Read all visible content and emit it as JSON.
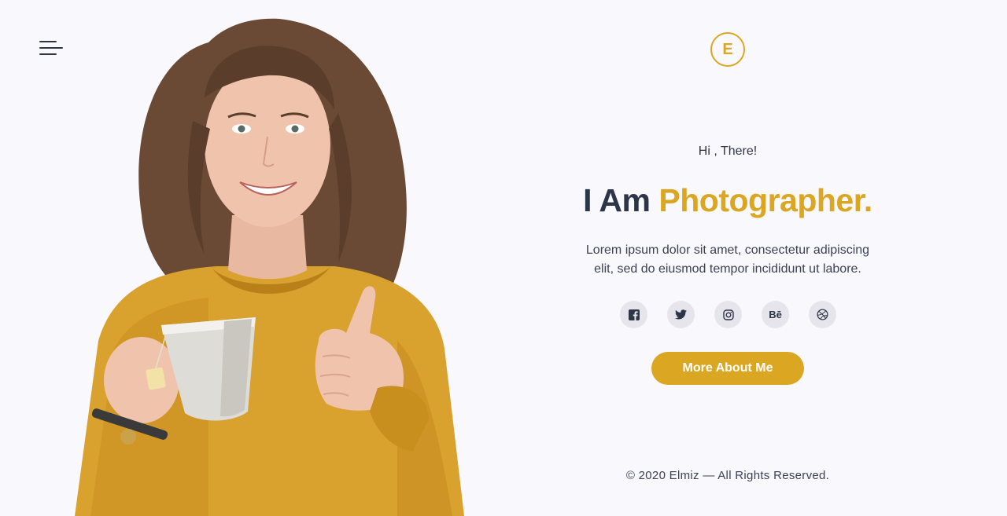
{
  "header": {
    "menu_icon": "hamburger-menu-icon",
    "logo_letter": "E"
  },
  "hero": {
    "greeting": "Hi , There!",
    "headline_prefix": "I Am ",
    "headline_accent": "Photographer.",
    "intro_line1": "Lorem ipsum dolor sit amet, consectetur adipiscing",
    "intro_line2": "elit, sed do eiusmod tempor incididunt ut labore.",
    "cta_label": "More About Me"
  },
  "socials": [
    {
      "icon": "facebook-icon",
      "glyph": "f"
    },
    {
      "icon": "twitter-icon",
      "glyph": "t"
    },
    {
      "icon": "instagram-icon",
      "glyph": "ig"
    },
    {
      "icon": "behance-icon",
      "glyph": "Bē"
    },
    {
      "icon": "dribbble-icon",
      "glyph": "d"
    }
  ],
  "footer": {
    "copyright": "© 2020 Elmiz — All Rights Reserved."
  },
  "colors": {
    "accent": "#dba723",
    "text": "#2d3648",
    "background": "#f9f8fd",
    "social_bg": "#e6e5ec"
  }
}
